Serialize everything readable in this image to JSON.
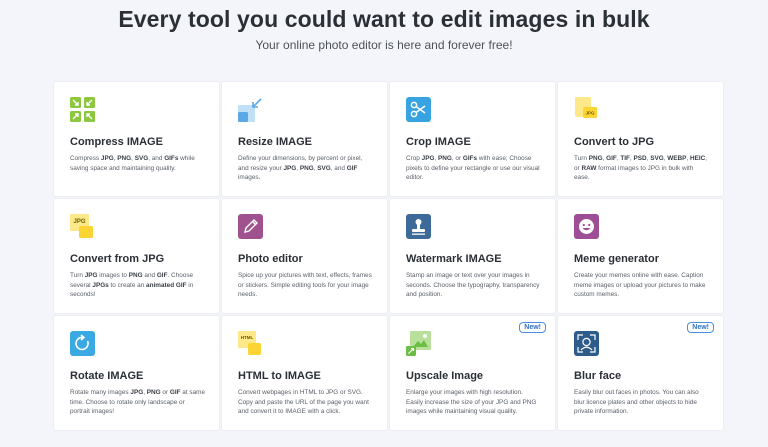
{
  "hero": {
    "title": "Every tool you could want to edit images in bulk",
    "subtitle": "Your online photo editor is here and forever free!"
  },
  "colors": {
    "compress": "#8dc63f",
    "resize": "#5aa9e6",
    "crop": "#37a3e0",
    "jpg_yellow": "#fcd535",
    "photo_editor": "#a0528f",
    "watermark": "#3d6a98",
    "meme": "#9d4e96",
    "rotate": "#3aa8e3",
    "upscale": "#6cbd45",
    "blur": "#2e5c8a",
    "badge": "#4a90e2"
  },
  "tools": [
    {
      "id": "compress",
      "icon": "compress-icon",
      "title": "Compress IMAGE",
      "desc": [
        [
          "Compress ",
          ""
        ],
        [
          "JPG",
          "b"
        ],
        [
          ", ",
          ""
        ],
        [
          "PNG",
          "b"
        ],
        [
          ", ",
          ""
        ],
        [
          "SVG",
          "b"
        ],
        [
          ", and ",
          ""
        ],
        [
          "GIFs",
          "b"
        ],
        [
          " while saving space and maintaining quality.",
          ""
        ]
      ]
    },
    {
      "id": "resize",
      "icon": "resize-icon",
      "title": "Resize IMAGE",
      "desc": [
        [
          "Define your dimensions, by percent or pixel, and resize your ",
          ""
        ],
        [
          "JPG",
          "b"
        ],
        [
          ", ",
          ""
        ],
        [
          "PNG",
          "b"
        ],
        [
          ", ",
          ""
        ],
        [
          "SVG",
          "b"
        ],
        [
          ", and ",
          ""
        ],
        [
          "GIF",
          "b"
        ],
        [
          " images.",
          ""
        ]
      ]
    },
    {
      "id": "crop",
      "icon": "scissors-icon",
      "title": "Crop IMAGE",
      "desc": [
        [
          "Crop ",
          ""
        ],
        [
          "JPG",
          "b"
        ],
        [
          ", ",
          ""
        ],
        [
          "PNG",
          "b"
        ],
        [
          ", or ",
          ""
        ],
        [
          "GIFs",
          "b"
        ],
        [
          " with ease; Choose pixels to define your rectangle or use our visual editor.",
          ""
        ]
      ]
    },
    {
      "id": "to_jpg",
      "icon": "jpg-file-icon",
      "title": "Convert to JPG",
      "desc": [
        [
          "Turn ",
          ""
        ],
        [
          "PNG",
          "b"
        ],
        [
          ", ",
          ""
        ],
        [
          "GIF",
          "b"
        ],
        [
          ", ",
          ""
        ],
        [
          "TIF",
          "b"
        ],
        [
          ", ",
          ""
        ],
        [
          "PSD",
          "b"
        ],
        [
          ", ",
          ""
        ],
        [
          "SVG",
          "b"
        ],
        [
          ", ",
          ""
        ],
        [
          "WEBP",
          "b"
        ],
        [
          ", ",
          ""
        ],
        [
          "HEIC",
          "b"
        ],
        [
          ", or ",
          ""
        ],
        [
          "RAW",
          "b"
        ],
        [
          " format images to JPG in bulk with ease.",
          ""
        ]
      ]
    },
    {
      "id": "from_jpg",
      "icon": "jpg-convert-icon",
      "title": "Convert from JPG",
      "desc": [
        [
          "Turn ",
          ""
        ],
        [
          "JPG",
          "b"
        ],
        [
          " images to ",
          ""
        ],
        [
          "PNG",
          "b"
        ],
        [
          " and ",
          ""
        ],
        [
          "GIF",
          "b"
        ],
        [
          ". Choose several ",
          ""
        ],
        [
          "JPGs",
          "b"
        ],
        [
          " to create an ",
          ""
        ],
        [
          "animated GIF",
          "b"
        ],
        [
          " in seconds!",
          ""
        ]
      ]
    },
    {
      "id": "photo_editor",
      "icon": "pencil-icon",
      "title": "Photo editor",
      "desc": [
        [
          "Spice up your pictures with text, effects, frames or stickers. Simple editing tools for your image needs.",
          ""
        ]
      ]
    },
    {
      "id": "watermark",
      "icon": "stamp-icon",
      "title": "Watermark IMAGE",
      "desc": [
        [
          "Stamp an image or text over your images in seconds. Choose the typography, transparency and position.",
          ""
        ]
      ]
    },
    {
      "id": "meme",
      "icon": "meme-face-icon",
      "title": "Meme generator",
      "desc": [
        [
          "Create your memes online with ease. Caption meme images or upload your pictures to make custom memes.",
          ""
        ]
      ]
    },
    {
      "id": "rotate",
      "icon": "rotate-icon",
      "title": "Rotate IMAGE",
      "desc": [
        [
          "Rotate many images ",
          ""
        ],
        [
          "JPG",
          "b"
        ],
        [
          ", ",
          ""
        ],
        [
          "PNG",
          "b"
        ],
        [
          " or ",
          ""
        ],
        [
          "GIF",
          "b"
        ],
        [
          " at same time. Choose to rotate only landscape or portrait images!",
          ""
        ]
      ]
    },
    {
      "id": "html",
      "icon": "html-file-icon",
      "title": "HTML to IMAGE",
      "desc": [
        [
          "Convert webpages in HTML to JPG or SVG. Copy and paste the URL of the page you want and convert it to IMAGE with a click.",
          ""
        ]
      ]
    },
    {
      "id": "upscale",
      "icon": "upscale-icon",
      "title": "Upscale Image",
      "badge": "New!",
      "desc": [
        [
          "Enlarge your images with high resolution. Easily increase the size of your JPG and PNG images while maintaining visual quality.",
          ""
        ]
      ]
    },
    {
      "id": "blur",
      "icon": "blur-face-icon",
      "title": "Blur face",
      "badge": "New!",
      "desc": [
        [
          "Easily blur out faces in photos. You can also blur licence plates and other objects to hide private information.",
          ""
        ]
      ]
    }
  ]
}
